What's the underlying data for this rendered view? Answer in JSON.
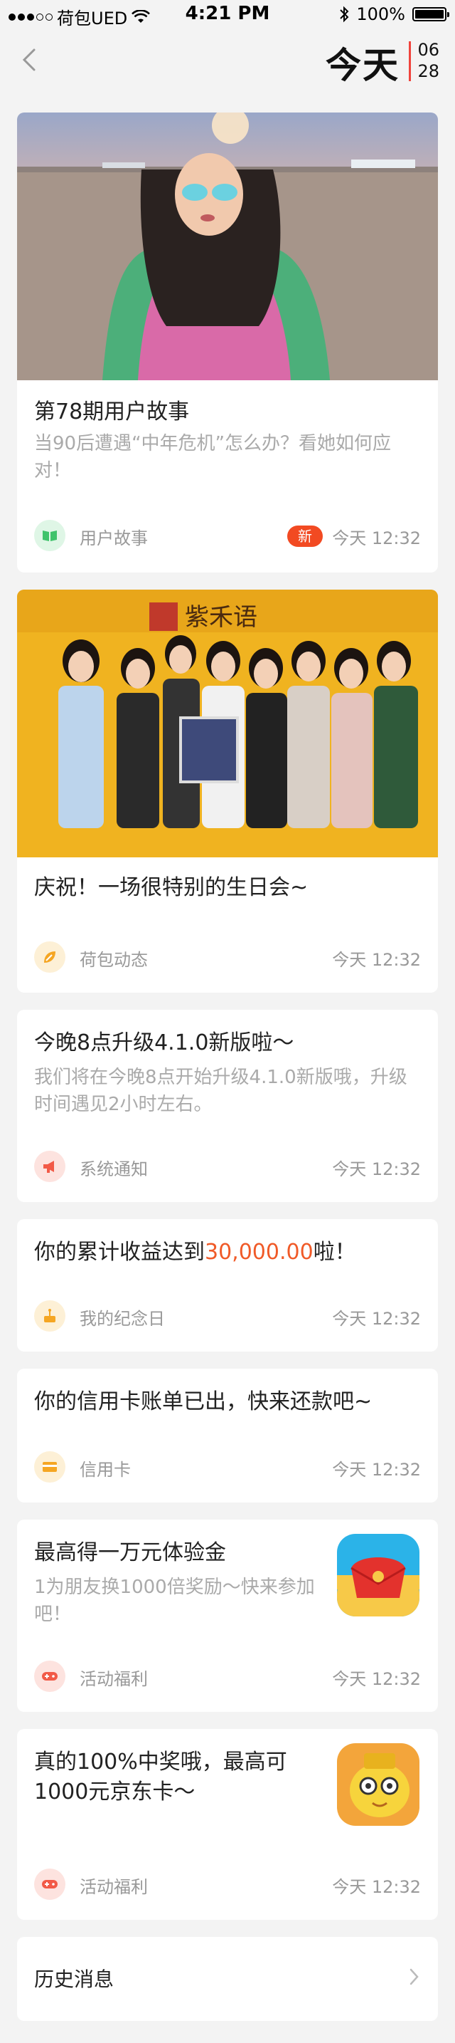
{
  "status_bar": {
    "carrier": "荷包UED",
    "time": "4:21 PM",
    "battery_text": "100%",
    "battery_level": 1.0
  },
  "header": {
    "title": "今天",
    "month": "06",
    "day": "28",
    "accent_color": "#f0433c"
  },
  "cards": [
    {
      "title": "第78期用户故事",
      "subtitle": "当90后遭遇“中年危机”怎么办？看她如何应对！",
      "category": "用户故事",
      "category_icon": "book-icon",
      "category_color": "#3fc36b",
      "badge": "新",
      "time": "今天 12:32"
    },
    {
      "title": "庆祝！一场很特别的生日会~",
      "image_sign": "紫禾语",
      "category": "荷包动态",
      "category_icon": "hebao-leaf-icon",
      "category_color": "#f5a623",
      "time": "今天 12:32"
    },
    {
      "title": "今晚8点升级4.1.0新版啦～",
      "subtitle": "我们将在今晚8点开始升级4.1.0新版哦，升级时间遇见2小时左右。",
      "category": "系统通知",
      "category_icon": "megaphone-icon",
      "category_color": "#f25a47",
      "time": "今天 12:32"
    },
    {
      "title_prefix": "你的累计收益达到",
      "title_highlight": "30,000.00",
      "title_suffix": "啦！",
      "category": "我的纪念日",
      "category_icon": "cake-icon",
      "category_color": "#f5a623",
      "time": "今天 12:32"
    },
    {
      "title": "你的信用卡账单已出，快来还款吧~",
      "category": "信用卡",
      "category_icon": "credit-card-icon",
      "category_color": "#f5a623",
      "time": "今天 12:32"
    },
    {
      "title": "最高得一万元体验金",
      "subtitle": "1为朋友换1000倍奖励～快来参加吧！",
      "category": "活动福利",
      "category_icon": "gamepad-icon",
      "category_color": "#f25a47",
      "promo_icon": "red-envelope-icon",
      "time": "今天 12:32"
    },
    {
      "title": "真的100%中奖哦，最高可1000元京东卡～",
      "category": "活动福利",
      "category_icon": "gamepad-icon",
      "category_color": "#f25a47",
      "promo_icon": "gold-piggy-mascot-icon",
      "time": "今天 12:32"
    }
  ],
  "history": {
    "label": "历史消息"
  }
}
